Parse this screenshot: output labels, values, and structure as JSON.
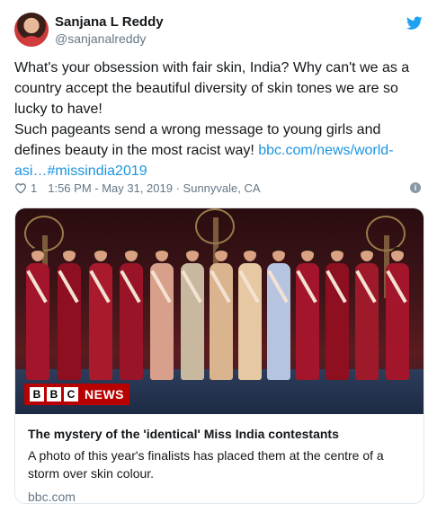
{
  "user": {
    "display_name": "Sanjana L Reddy",
    "handle": "@sanjanalreddy"
  },
  "tweet": {
    "text_main": "What's your obsession with fair skin, India? Why can't we as a country accept the beautiful diversity of skin tones we are so lucky to have!\nSuch pageants send a wrong message to young girls and defines beauty in the most racist way! ",
    "link_text": "bbc.com/news/world-asi…",
    "hashtag": "#missindia2019"
  },
  "meta": {
    "likes": "1",
    "time": "1:56 PM - May 31, 2019",
    "separator": " · ",
    "location": "Sunnyvale, CA",
    "info_symbol": "i"
  },
  "card": {
    "logo_box_1": "B",
    "logo_box_2": "B",
    "logo_box_3": "C",
    "logo_news": "NEWS",
    "title": "The mystery of the 'identical' Miss India contestants",
    "description": "A photo of this year's finalists has placed them at the centre of a storm over skin colour.",
    "domain": "bbc.com"
  },
  "colors": {
    "link": "#1b95e0",
    "twitter_blue": "#1da1f2",
    "bbc_red": "#b80000"
  },
  "icons": {
    "brand": "twitter-bird-icon",
    "like": "heart-icon",
    "info": "info-icon"
  }
}
